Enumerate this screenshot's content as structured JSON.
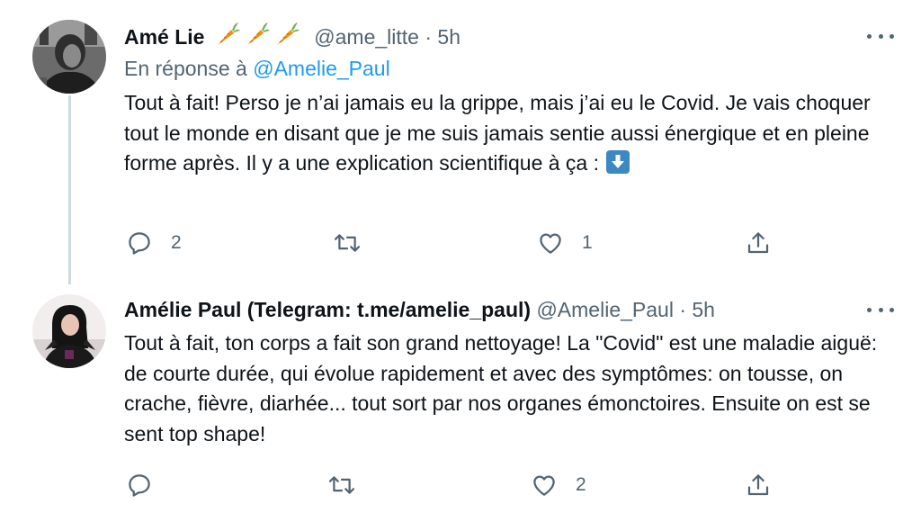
{
  "tweets": [
    {
      "display_name": "Amé Lie",
      "name_emoji": "carrot-icon ×3",
      "handle": "@ame_litte",
      "separator": "·",
      "time": "5h",
      "reply_prefix": "En réponse à",
      "reply_handle": "@Amelie_Paul",
      "text": "Tout à fait! Perso je n’ai jamais eu la grippe, mais j’ai eu le Covid. Je vais choquer tout le monde en disant que je me suis jamais sentie aussi énergique et en pleine forme après. Il y a une explication scientifique à ça :",
      "text_emoji": "down-arrow-emoji",
      "reply_count": "2",
      "retweet_count": "",
      "like_count": "1"
    },
    {
      "display_name": "Amélie Paul (Telegram: t.me/amelie_paul)",
      "handle": "@Amelie_Paul",
      "separator": "·",
      "time": "5h",
      "text": "Tout à fait, ton corps a fait son grand nettoyage! La \"Covid\" est une maladie aiguë: de courte durée, qui évolue rapidement et avec des symptômes: on tousse, on crache, fièvre, diarhée... tout sort par nos organes émonctoires. Ensuite on est se sent top shape!",
      "reply_count": "",
      "retweet_count": "",
      "like_count": "2"
    }
  ],
  "colors": {
    "link": "#1d9bf0",
    "muted": "#536471",
    "text": "#0f1419",
    "thread_line": "#cfd9de",
    "carrot": "#f4900c",
    "carrot_leaf": "#77b255",
    "arrow_emoji": "#3b88c3"
  }
}
